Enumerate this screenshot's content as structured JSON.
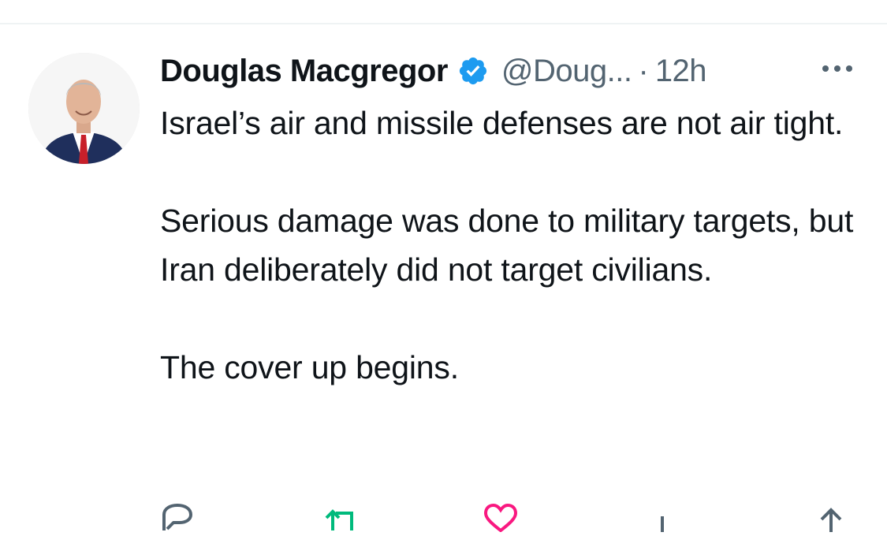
{
  "tweet": {
    "author_name": "Douglas Macgregor",
    "handle": "@Doug...",
    "separator": "·",
    "time": "12h",
    "paragraphs": [
      "Israel’s air and missile defenses are not air tight.",
      "Serious damage was done to military targets, but Iran deliberately did not target civilians.",
      "The cover up begins."
    ]
  },
  "icons": {
    "verified": "verified-badge-icon",
    "more": "more-horizontal-icon",
    "reply": "reply-icon",
    "retweet": "retweet-icon",
    "like": "like-icon",
    "views": "views-icon",
    "share": "share-icon"
  },
  "colors": {
    "verified": "#1d9bf0",
    "secondary_text": "#536471",
    "retweet": "#00ba7c",
    "like": "#f91880"
  }
}
